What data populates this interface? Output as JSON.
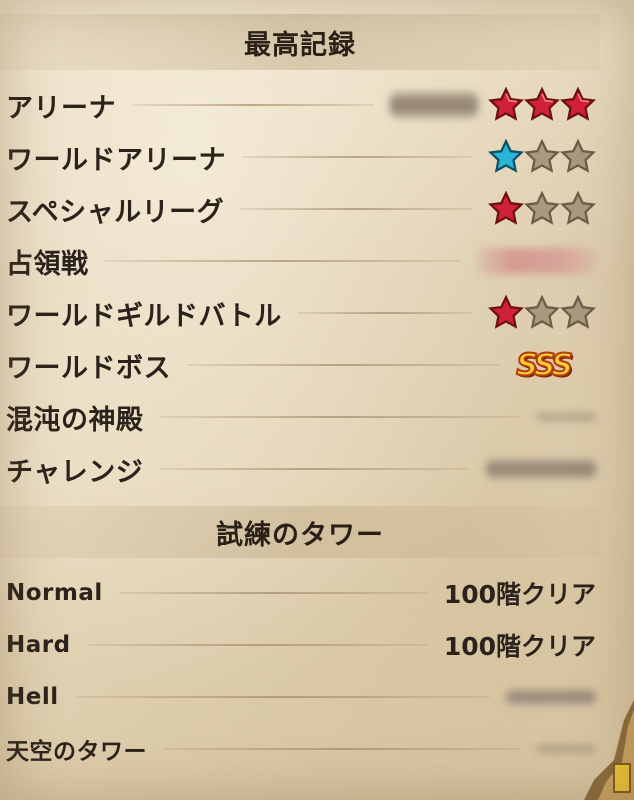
{
  "best_records": {
    "title": "最高記録",
    "rows": [
      {
        "label": "アリーナ",
        "stars": [
          "red",
          "red",
          "red"
        ],
        "note": "blurred badge"
      },
      {
        "label": "ワールドアリーナ",
        "stars": [
          "cyan",
          "gray",
          "gray"
        ]
      },
      {
        "label": "スペシャルリーグ",
        "stars": [
          "red",
          "gray",
          "gray"
        ]
      },
      {
        "label": "占領戦"
      },
      {
        "label": "ワールドギルドバトル",
        "stars": [
          "red",
          "gray",
          "gray"
        ]
      },
      {
        "label": "ワールドボス",
        "rank": "SSS"
      },
      {
        "label": "混沌の神殿"
      },
      {
        "label": "チャレンジ"
      }
    ]
  },
  "trial_tower": {
    "title": "試練のタワー",
    "rows": [
      {
        "label": "Normal",
        "value": "100階クリア"
      },
      {
        "label": "Hard",
        "value": "100階クリア"
      },
      {
        "label": "Hell",
        "value": ""
      },
      {
        "label": "天空のタワー",
        "value": ""
      }
    ]
  },
  "colors": {
    "star_red": "#d1203a",
    "star_cyan": "#29b6d6",
    "star_gray": "#a8997f",
    "parchment": "#e6d8bb"
  }
}
